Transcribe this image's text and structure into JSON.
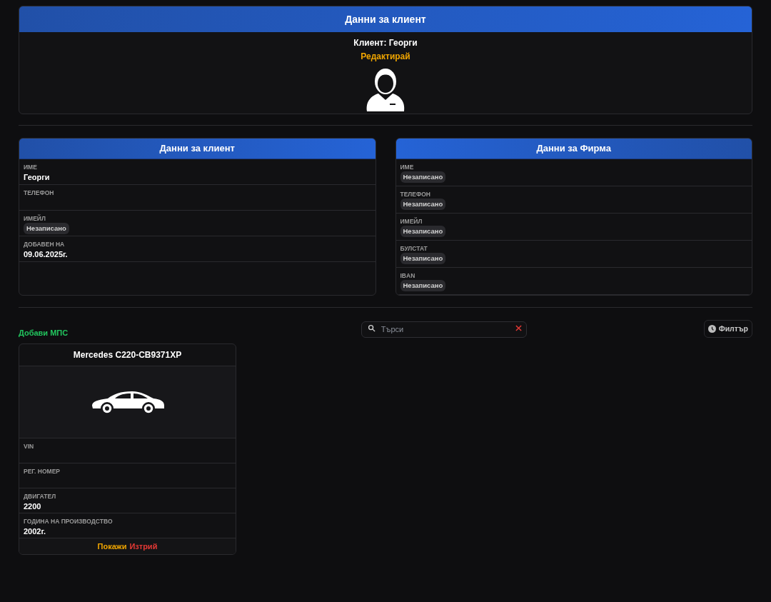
{
  "client_header": {
    "title": "Данни за клиент",
    "client_line": "Клиент: Георги",
    "edit_link": "Редактирай"
  },
  "client_card": {
    "title": "Данни за клиент",
    "fields": [
      {
        "label": "ИМЕ",
        "kind": "text",
        "value": "Георги"
      },
      {
        "label": "ТЕЛЕФОН",
        "kind": "empty"
      },
      {
        "label": "ИМЕЙЛ",
        "kind": "badge",
        "value": "Незаписано"
      },
      {
        "label": "ДОБАВЕН НА",
        "kind": "text",
        "value": "09.06.2025г."
      }
    ]
  },
  "company_card": {
    "title": "Данни за Фирма",
    "fields": [
      {
        "label": "ИМЕ",
        "kind": "badge",
        "value": "Незаписано"
      },
      {
        "label": "ТЕЛЕФОН",
        "kind": "badge",
        "value": "Незаписано"
      },
      {
        "label": "ИМЕЙЛ",
        "kind": "badge",
        "value": "Незаписано"
      },
      {
        "label": "БУЛСТАТ",
        "kind": "badge",
        "value": "Незаписано"
      },
      {
        "label": "IBAN",
        "kind": "badge",
        "value": "Незаписано"
      }
    ]
  },
  "toolbar": {
    "add_link": "Добави МПС",
    "search": {
      "placeholder": "Търси"
    },
    "filter_button": "Филтър"
  },
  "vehicles": [
    {
      "title": "Mercedes C220-CB9371XP",
      "fields": [
        {
          "label": "VIN",
          "kind": "empty"
        },
        {
          "label": "РЕГ. НОМЕР",
          "kind": "empty"
        },
        {
          "label": "ДВИГАТЕЛ",
          "kind": "text",
          "value": "2200"
        },
        {
          "label": "ГОДИНА НА ПРОИЗВОДСТВО",
          "kind": "text",
          "value": "2002г."
        }
      ],
      "show_link": "Покажи",
      "delete_link": "Изтрий"
    }
  ]
}
